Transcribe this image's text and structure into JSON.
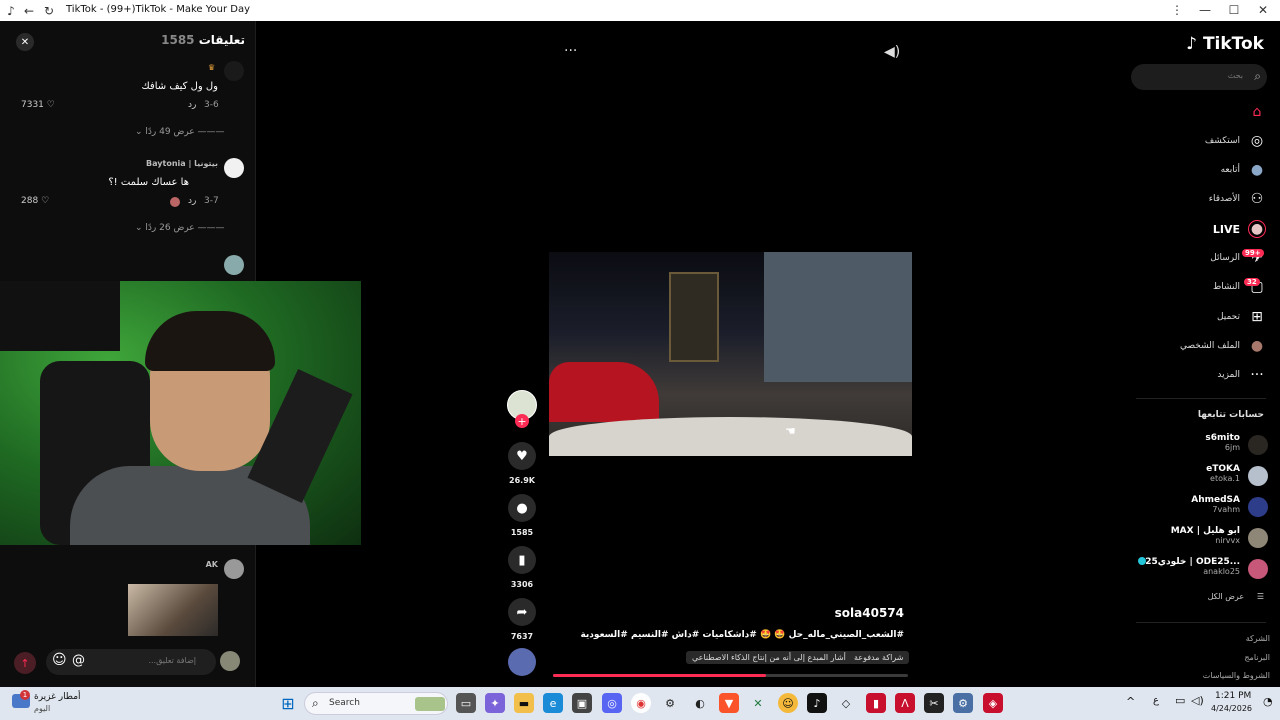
{
  "window": {
    "title": "TikTok - (99+)TikTok - Make Your Day",
    "controls": {
      "minimize": "—",
      "maximize": "☐",
      "close": "✕"
    }
  },
  "comments_panel": {
    "title": "تعليقات",
    "count": "1585",
    "close": "✕",
    "items": [
      {
        "text": "ول ول كيف شافك",
        "date": "3-6",
        "reply": "رد",
        "likes": "7331",
        "view_replies": "عرض 49 ردًا"
      },
      {
        "author": "Baytonia | بيتونيا",
        "text": "ها عساك سلمت !؟",
        "date": "3-7",
        "reply": "رد",
        "likes": "288",
        "view_replies": "عرض 26 ردًا"
      },
      {
        "author": "AK"
      }
    ],
    "input_placeholder": "إضافة تعليق...",
    "emoji_icon": "☺",
    "mention_icon": "@"
  },
  "video": {
    "author": "sola40574",
    "caption": "#الشعب_الصيني_ماله_حل 🤩 🤩 #داشكاميات #داش #النسيم #السعودية",
    "tags": [
      "شراكة مدفوعة",
      "أشار المبدع إلى أنه من إنتاج الذكاء الاصطناعي"
    ],
    "progress": 0.6,
    "more": "···",
    "actions": {
      "likes": "26.9K",
      "comments": "1585",
      "saves": "3306",
      "shares": "7637"
    }
  },
  "sidebar": {
    "logo": "TikTok",
    "search_placeholder": "بحث",
    "nav": [
      {
        "label": "",
        "icon": "home-icon",
        "glyph": "⌂"
      },
      {
        "label": "استكشف",
        "icon": "compass-icon",
        "glyph": "◎"
      },
      {
        "label": "أتابعه",
        "icon": "avatar-icon",
        "glyph": "●"
      },
      {
        "label": "الأصدقاء",
        "icon": "friends-icon",
        "glyph": "⚇"
      },
      {
        "label": "LIVE",
        "icon": "live-icon",
        "glyph": "●"
      },
      {
        "label": "الرسائل",
        "icon": "messages-icon",
        "glyph": "✈",
        "badge": "99+"
      },
      {
        "label": "النشاط",
        "icon": "activity-icon",
        "glyph": "▢",
        "badge": "32"
      },
      {
        "label": "تحميل",
        "icon": "upload-icon",
        "glyph": "⊞"
      },
      {
        "label": "الملف الشخصي",
        "icon": "profile-icon",
        "glyph": "●"
      },
      {
        "label": "المزيد",
        "icon": "more-icon",
        "glyph": "···"
      }
    ],
    "following_title": "حسابات تتابعها",
    "following": [
      {
        "name": "s6mito",
        "handle": "6jm"
      },
      {
        "name": "eTOKA",
        "handle": "etoka.1"
      },
      {
        "name": "AhmedSA",
        "handle": "7vahm"
      },
      {
        "name": "MAX | ابو هليل",
        "handle": "nirvvx"
      },
      {
        "name": "خلودي25 | ODE25...",
        "handle": "anaklo25"
      }
    ],
    "see_all": "عرض الكل",
    "footer": [
      "الشركة",
      "البرنامج",
      "الشروط والسياسات"
    ]
  },
  "taskbar": {
    "weather_text": "أمطار غزيرة",
    "weather_sub": "اليوم",
    "weather_badge": "1",
    "search": "Search",
    "lang": "ع",
    "time": "1:21 PM",
    "date": "4/24/2026"
  }
}
